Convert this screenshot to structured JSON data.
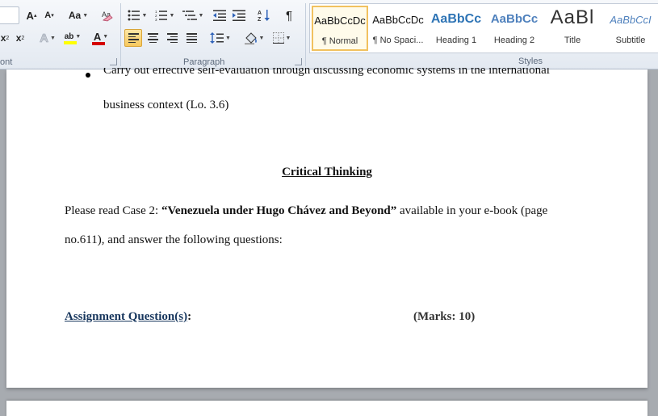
{
  "ribbon": {
    "font_group": {
      "label": "ont",
      "size_value": "",
      "grow_icon_text": "A",
      "shrink_icon_text": "A",
      "change_case_text": "Aa",
      "subscript_text": "x",
      "superscript_text": "x",
      "text_effects_text": "A",
      "highlight_text": "ab",
      "font_color_text": "A",
      "highlight_color": "#ffff00",
      "font_color": "#d40000"
    },
    "paragraph_group": {
      "label": "Paragraph",
      "pilcrow": "¶",
      "sort_text": "A↓"
    },
    "styles_group": {
      "label": "Styles",
      "tiles": [
        {
          "sample": "AaBbCcDc",
          "name": "¶ Normal"
        },
        {
          "sample": "AaBbCcDc",
          "name": "¶ No Spaci..."
        },
        {
          "sample": "AaBbCc",
          "name": "Heading 1"
        },
        {
          "sample": "AaBbCc",
          "name": "Heading 2"
        },
        {
          "sample": "AaBl",
          "name": "Title"
        },
        {
          "sample": "AaBbCcI",
          "name": "Subtitle"
        }
      ]
    }
  },
  "document": {
    "bullet_line_1": "Carry out effective self-evaluation through discussing economic systems in the international",
    "bullet_line_2": "business context (Lo. 3.6)",
    "heading": "Critical Thinking",
    "para_prefix": "Please read Case 2: ",
    "para_bold": "“Venezuela under Hugo Chávez and Beyond”",
    "para_suffix": " available in your e-book (page",
    "para_line_2": "no.611), and answer the following questions:",
    "assignment_label": "Assignment Question(s)",
    "assignment_colon": ":",
    "marks": "(Marks: 10)"
  },
  "colors": {
    "assignment_text": "#17365d",
    "heading1_style": "#2e74b5",
    "heading2_style": "#4f81bd",
    "subtitle_style": "#4f81bd"
  }
}
